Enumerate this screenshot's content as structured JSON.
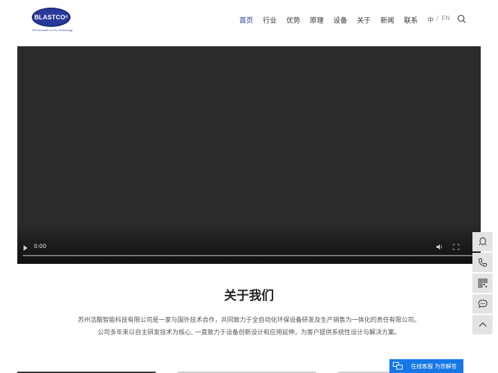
{
  "logo": {
    "text": "BLASTCO",
    "tagline": "The Innovator in CO₂ Technology"
  },
  "nav": {
    "items": [
      {
        "label": "首页"
      },
      {
        "label": "行业"
      },
      {
        "label": "优势"
      },
      {
        "label": "原理"
      },
      {
        "label": "设备"
      },
      {
        "label": "关于"
      },
      {
        "label": "新闻"
      },
      {
        "label": "联系"
      }
    ]
  },
  "lang": {
    "zh": "中",
    "sep": "/",
    "en": "EN"
  },
  "video": {
    "time": "0:00"
  },
  "about": {
    "title": "关于我们",
    "line1": "苏州洁酷智能科技有限公司是一家与国外技术合作，共同致力于全自动化环保设备研发及生产销售为一体化的责任有限公司。",
    "line2": "公司多年来以自主研发技术为核心, 一直致力于设备创新设计和应用延伸，为客户提供系统性设计与解决方案。"
  },
  "chat": {
    "label": "在线客服 为您解答"
  },
  "colors": {
    "brand": "#2b3896",
    "chat": "#1677e6"
  }
}
